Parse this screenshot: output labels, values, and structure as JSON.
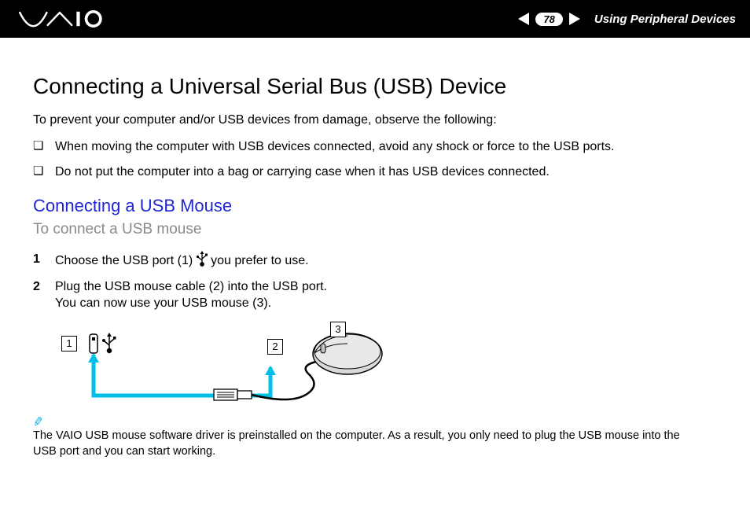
{
  "header": {
    "page_number": "78",
    "section": "Using Peripheral Devices"
  },
  "title": "Connecting a Universal Serial Bus (USB) Device",
  "intro": "To prevent your computer and/or USB devices from damage, observe the following:",
  "bullets": [
    "When moving the computer with USB devices connected, avoid any shock or force to the USB ports.",
    "Do not put the computer into a bag or carrying case when it has USB devices connected."
  ],
  "subheading": "Connecting a USB Mouse",
  "task": "To connect a USB mouse",
  "steps": [
    {
      "pre": "Choose the USB port (1) ",
      "post": " you prefer to use."
    },
    {
      "pre": "Plug the USB mouse cable (2) into the USB port.",
      "post": "",
      "extra": "You can now use your USB mouse (3)."
    }
  ],
  "callouts": {
    "c1": "1",
    "c2": "2",
    "c3": "3"
  },
  "note": "The VAIO USB mouse software driver is preinstalled on the computer. As a result, you only need to plug the USB mouse into the USB port and you can start working."
}
